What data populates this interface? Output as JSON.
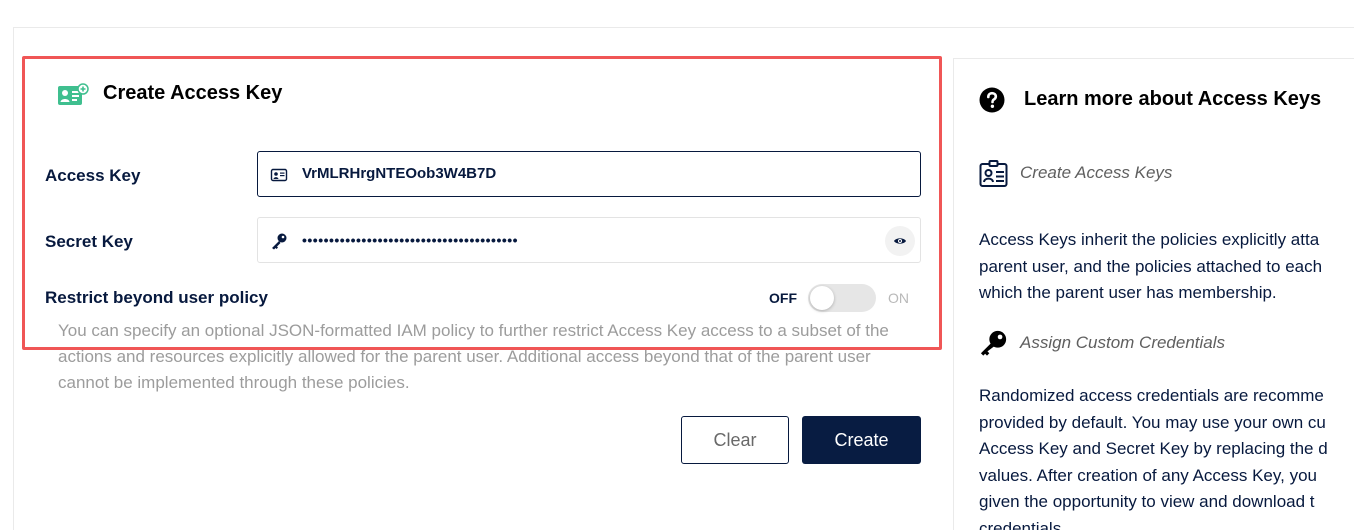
{
  "form": {
    "title": "Create Access Key",
    "access_key_label": "Access Key",
    "access_key_value": "VrMLRHrgNTEOob3W4B7D",
    "secret_key_label": "Secret Key",
    "secret_key_masked": "••••••••••••••••••••••••••••••••••••••••",
    "restrict_label": "Restrict beyond user policy",
    "toggle_off_label": "OFF",
    "toggle_on_label": "ON",
    "toggle_state": "off",
    "helper_text": "You can specify an optional JSON-formatted IAM policy to further restrict Access Key access to a subset of the actions and resources explicitly allowed for the parent user. Additional access beyond that of the parent user cannot be implemented through these policies.",
    "clear_label": "Clear",
    "create_label": "Create"
  },
  "help": {
    "title": "Learn more about Access Keys",
    "sections": [
      {
        "title": "Create Access Keys",
        "text_lines": [
          "Access Keys inherit the policies explicitly atta",
          "parent user, and the policies attached to each",
          "which the parent user has membership."
        ]
      },
      {
        "title": "Assign Custom Credentials",
        "text_lines": [
          "Randomized access credentials are recomme",
          "provided by default. You may use your own cu",
          "Access Key and Secret Key by replacing the d",
          "values. After creation of any Access Key, you",
          "given the opportunity to view and download t",
          "credentials."
        ]
      }
    ]
  },
  "colors": {
    "highlight": "#f05656",
    "navy": "#07193e",
    "create_button": "#081c42",
    "icon_green": "#3fbf8f"
  },
  "icons": {
    "form": "access-key-id-card-icon",
    "access_input": "id-card-icon",
    "secret_input": "key-icon",
    "show_password": "eye-icon",
    "help": "question-circle-icon",
    "section1": "id-card-icon",
    "section2": "key-icon"
  }
}
